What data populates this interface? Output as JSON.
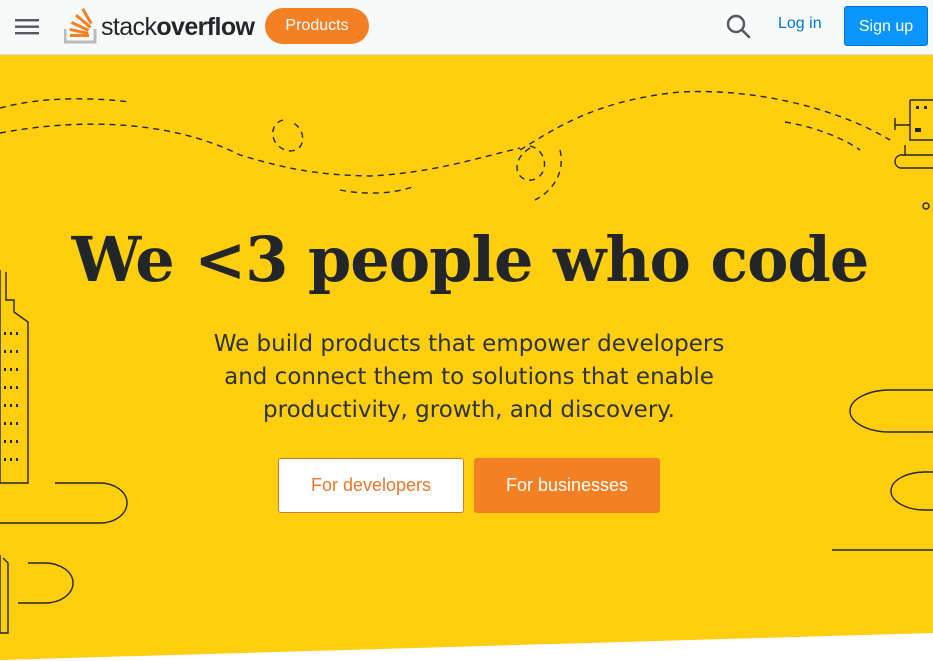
{
  "header": {
    "menu_icon": "hamburger-menu-icon",
    "logo_icon": "stackoverflow-logo-icon",
    "logo_word_regular": "stack",
    "logo_word_bold": "overflow",
    "products_label": "Products",
    "search_icon": "search-icon",
    "login_label": "Log in",
    "signup_label": "Sign up"
  },
  "hero": {
    "title": "We <3 people who code",
    "subtitle": "We build products that empower developers and connect them to solutions that enable productivity, growth, and discovery.",
    "developers_button": "For developers",
    "businesses_button": "For businesses"
  },
  "colors": {
    "brand_orange": "#f48024",
    "hero_yellow": "#fece0f",
    "link_blue": "#0077cc",
    "signup_blue": "#0a95ff"
  }
}
